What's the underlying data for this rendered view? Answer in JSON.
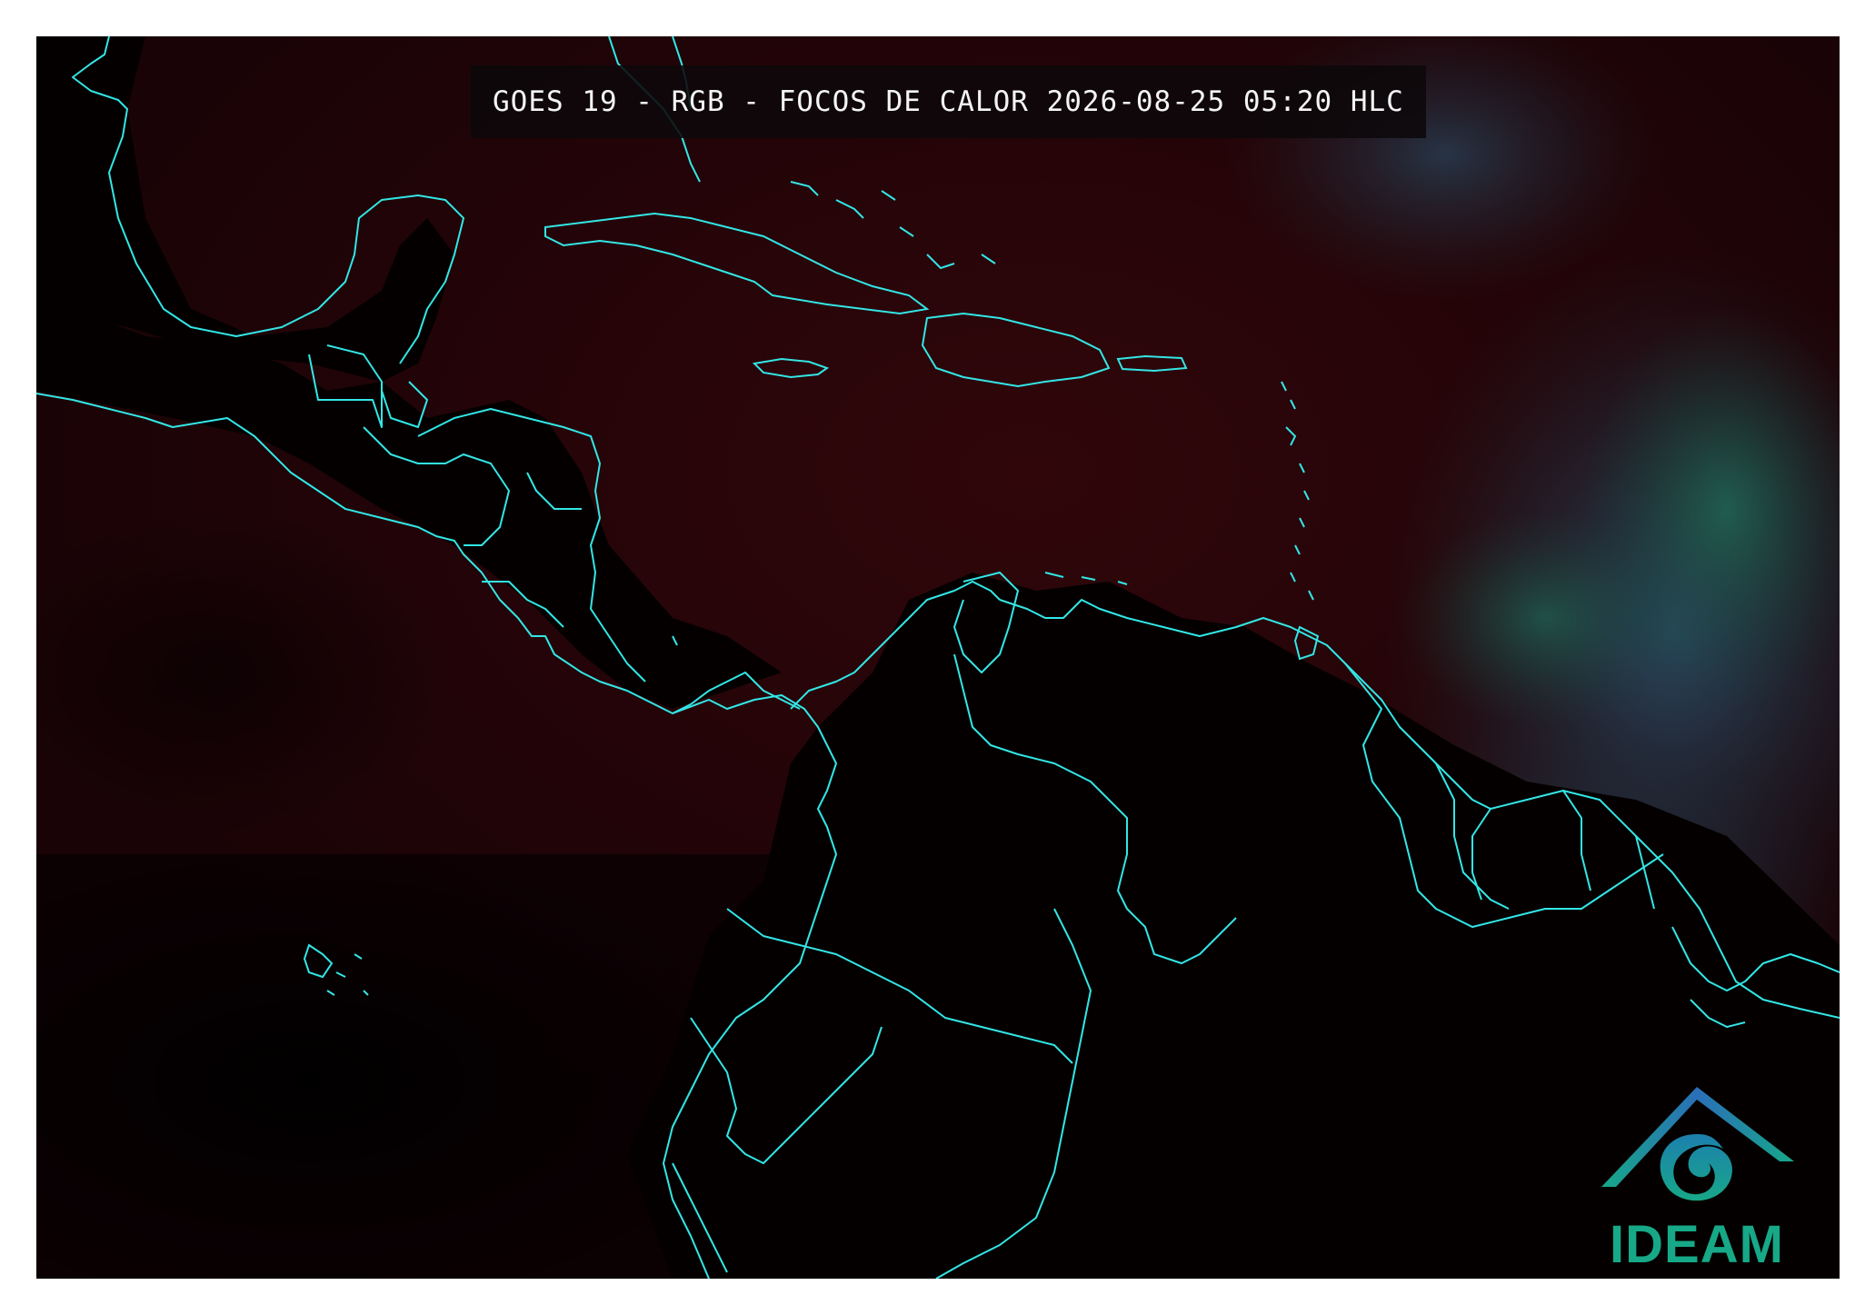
{
  "map": {
    "title": "GOES 19 - RGB - FOCOS DE CALOR 2026-08-25 05:20 HLC",
    "product": "RGB - FOCOS DE CALOR",
    "satellite": "GOES 19",
    "colors": {
      "background": "#0a0103",
      "land_dark": "#050000",
      "sea_red": "#2a0508",
      "clouds_blue": "#24485e",
      "clouds_green": "#1d5a48",
      "boundaries": "#33e6e6",
      "frame": "#ffffff"
    }
  },
  "logo": {
    "name": "IDEAM",
    "icon": "ideam-logo-icon",
    "text_color": "#17a888",
    "roof_color": "#2a6fb8"
  }
}
